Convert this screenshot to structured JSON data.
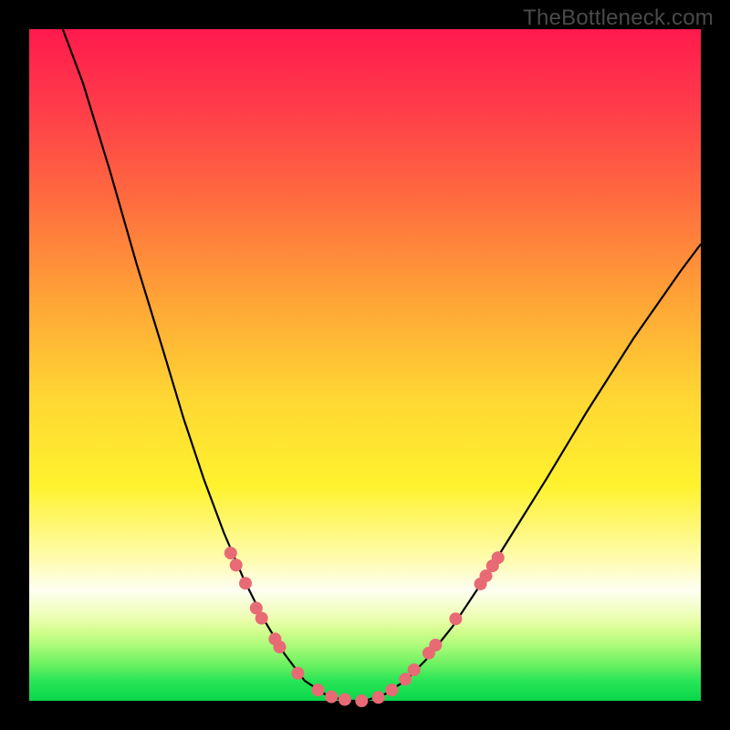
{
  "watermark": "TheBottleneck.com",
  "colors": {
    "frame": "#000000",
    "marker": "#e86a74",
    "curve": "#000000"
  },
  "chart_data": {
    "type": "line",
    "title": "",
    "xlabel": "",
    "ylabel": "",
    "xlim": [
      0,
      100
    ],
    "ylim": [
      0,
      100
    ],
    "curve": [
      {
        "x": 5,
        "y": 100
      },
      {
        "x": 8,
        "y": 92
      },
      {
        "x": 12,
        "y": 79
      },
      {
        "x": 16,
        "y": 65
      },
      {
        "x": 20,
        "y": 52
      },
      {
        "x": 23,
        "y": 42
      },
      {
        "x": 26,
        "y": 33
      },
      {
        "x": 29,
        "y": 25
      },
      {
        "x": 32,
        "y": 18
      },
      {
        "x": 35,
        "y": 12
      },
      {
        "x": 38,
        "y": 7
      },
      {
        "x": 41,
        "y": 3
      },
      {
        "x": 44,
        "y": 1
      },
      {
        "x": 47,
        "y": 0
      },
      {
        "x": 50,
        "y": 0
      },
      {
        "x": 53,
        "y": 1
      },
      {
        "x": 56,
        "y": 3
      },
      {
        "x": 59,
        "y": 6
      },
      {
        "x": 63,
        "y": 11
      },
      {
        "x": 67,
        "y": 17
      },
      {
        "x": 72,
        "y": 25
      },
      {
        "x": 77,
        "y": 33
      },
      {
        "x": 83,
        "y": 43
      },
      {
        "x": 90,
        "y": 54
      },
      {
        "x": 97,
        "y": 64
      },
      {
        "x": 100,
        "y": 68
      }
    ],
    "markers": [
      {
        "x": 30.0,
        "y": 22.0
      },
      {
        "x": 30.8,
        "y": 20.2
      },
      {
        "x": 32.2,
        "y": 17.5
      },
      {
        "x": 33.8,
        "y": 13.8
      },
      {
        "x": 34.6,
        "y": 12.3
      },
      {
        "x": 36.6,
        "y": 9.2
      },
      {
        "x": 37.3,
        "y": 8.0
      },
      {
        "x": 40.0,
        "y": 4.1
      },
      {
        "x": 43.0,
        "y": 1.6
      },
      {
        "x": 45.0,
        "y": 0.6
      },
      {
        "x": 47.0,
        "y": 0.2
      },
      {
        "x": 49.5,
        "y": 0.0
      },
      {
        "x": 52.0,
        "y": 0.5
      },
      {
        "x": 54.0,
        "y": 1.6
      },
      {
        "x": 56.0,
        "y": 3.2
      },
      {
        "x": 57.3,
        "y": 4.6
      },
      {
        "x": 59.5,
        "y": 7.1
      },
      {
        "x": 60.5,
        "y": 8.3
      },
      {
        "x": 63.5,
        "y": 12.2
      },
      {
        "x": 67.2,
        "y": 17.4
      },
      {
        "x": 68.0,
        "y": 18.6
      },
      {
        "x": 69.0,
        "y": 20.1
      },
      {
        "x": 69.8,
        "y": 21.3
      }
    ]
  }
}
